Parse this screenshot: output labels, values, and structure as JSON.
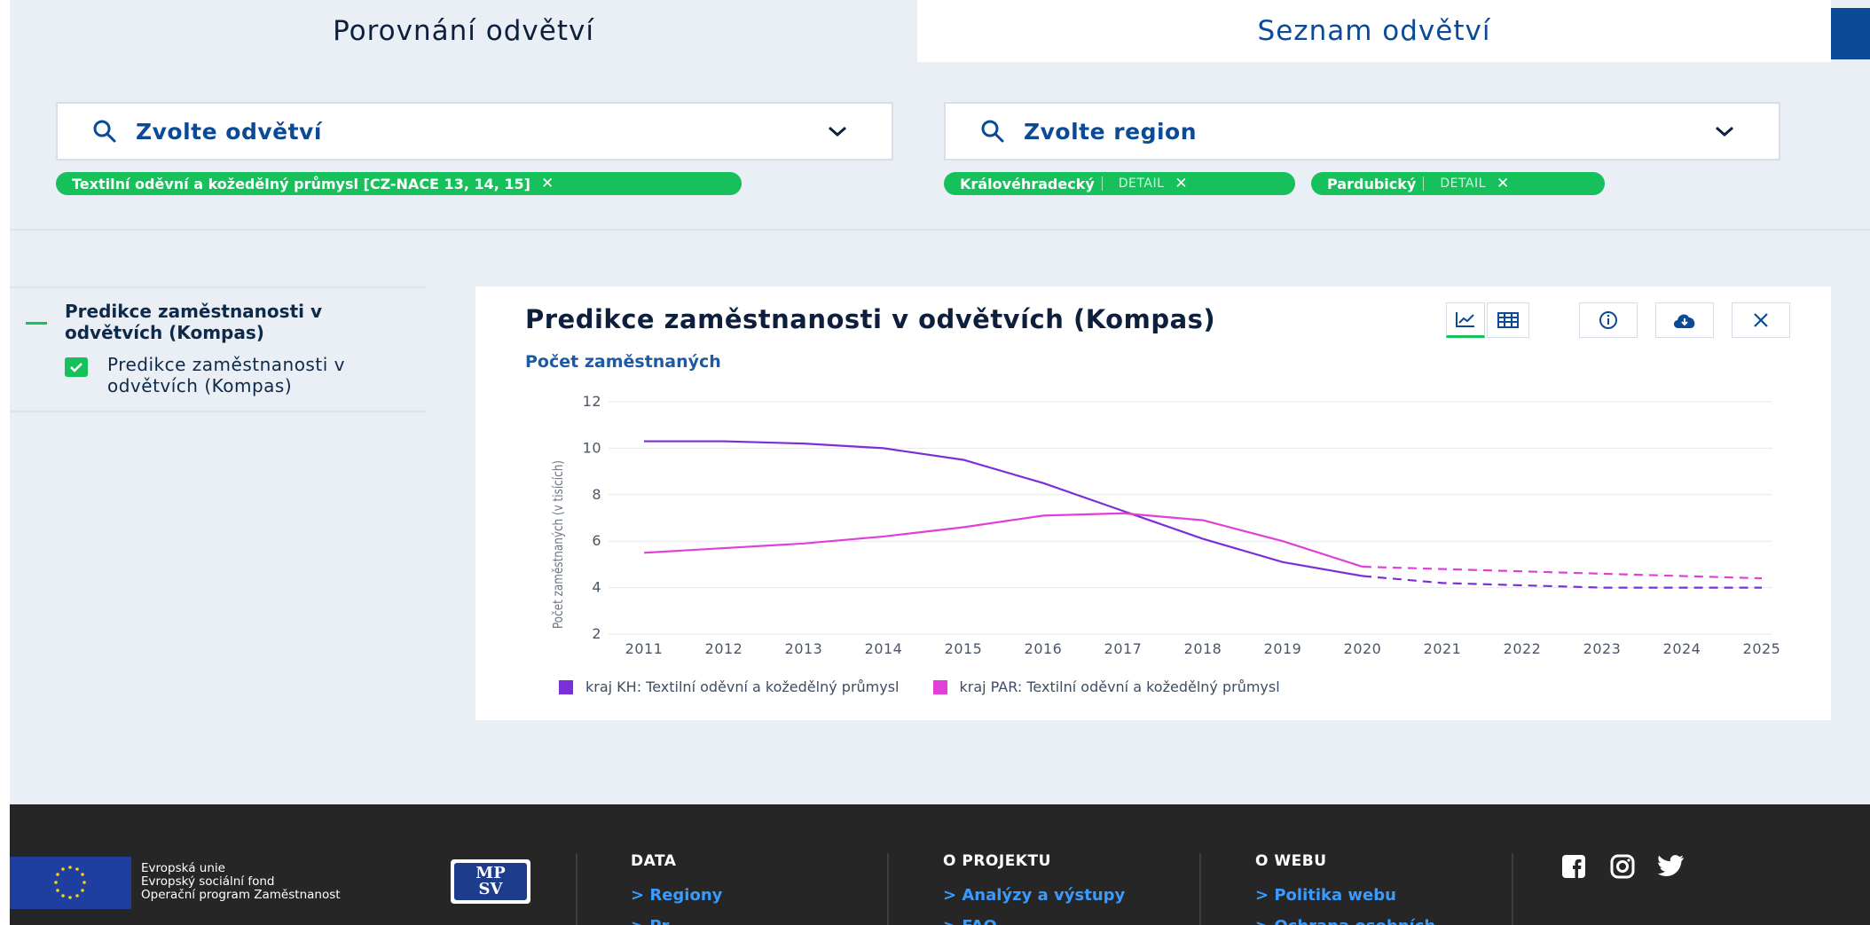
{
  "tabs": [
    "Porovnání odvětví",
    "Seznam odvětví"
  ],
  "filters": {
    "sector_select": {
      "label": "Zvolte odvětví"
    },
    "region_select": {
      "label": "Zvolte region"
    },
    "sector_chips": [
      {
        "label": "Textilní oděvní a kožedělný průmysl [CZ-NACE 13, 14, 15]",
        "remove": "✕"
      }
    ],
    "region_chips": [
      {
        "label": "Královéhradecký",
        "detail": "DETAIL",
        "remove": "✕"
      },
      {
        "label": "Pardubický",
        "detail": "DETAIL",
        "remove": "✕"
      }
    ]
  },
  "legend_panel": {
    "title": "Predikce zaměstnanosti v odvětvích (Kompas)",
    "item": "Predikce zaměstnanosti v odvětvích (Kompas)"
  },
  "chart_card": {
    "title": "Predikce zaměstnanosti v odvětvích (Kompas)",
    "subtitle": "Počet zaměstnaných",
    "toolbar": [
      "line-chart",
      "table",
      "info",
      "download",
      "close"
    ]
  },
  "chart_data": {
    "type": "line",
    "title": "Predikce zaměstnanosti v odvětvích (Kompas)",
    "subtitle": "Počet zaměstnaných",
    "xlabel": "",
    "ylabel": "Počet zaměstnaných (v tisících)",
    "x": [
      2011,
      2012,
      2013,
      2014,
      2015,
      2016,
      2017,
      2018,
      2019,
      2020,
      2021,
      2022,
      2023,
      2024,
      2025
    ],
    "ylim": [
      2,
      12
    ],
    "yticks": [
      2,
      4,
      6,
      8,
      10,
      12
    ],
    "grid": true,
    "legend": "bottom-left",
    "forecast_from": 2020,
    "series": [
      {
        "name": "kraj KH: Textilní oděvní a kožedělný průmysl",
        "color": "#7b2fd8",
        "values": [
          10.3,
          10.3,
          10.2,
          10.0,
          9.5,
          8.5,
          7.3,
          6.1,
          5.1,
          4.5,
          4.2,
          4.1,
          4.0,
          4.0,
          4.0
        ]
      },
      {
        "name": "kraj PAR: Textilní oděvní a kožedělný průmysl",
        "color": "#e040d8",
        "values": [
          5.5,
          5.7,
          5.9,
          6.2,
          6.6,
          7.1,
          7.2,
          6.9,
          6.0,
          4.9,
          4.8,
          4.7,
          4.6,
          4.5,
          4.4
        ]
      }
    ]
  },
  "footer": {
    "eu_lines": [
      "Evropská unie",
      "Evropský sociální fond",
      "Operační program Zaměstnanost"
    ],
    "mpsv_logo": [
      "MP",
      "SV"
    ],
    "columns": [
      {
        "heading": "DATA",
        "links": [
          "> Regiony",
          "> Pr..."
        ]
      },
      {
        "heading": "O PROJEKTU",
        "links": [
          "> Analýzy a výstupy",
          "> FAQ"
        ]
      },
      {
        "heading": "O WEBU",
        "links": [
          "> Politika webu",
          "> Ochrana osobních..."
        ]
      }
    ],
    "social": [
      "facebook-icon",
      "instagram-icon",
      "twitter-icon"
    ]
  }
}
